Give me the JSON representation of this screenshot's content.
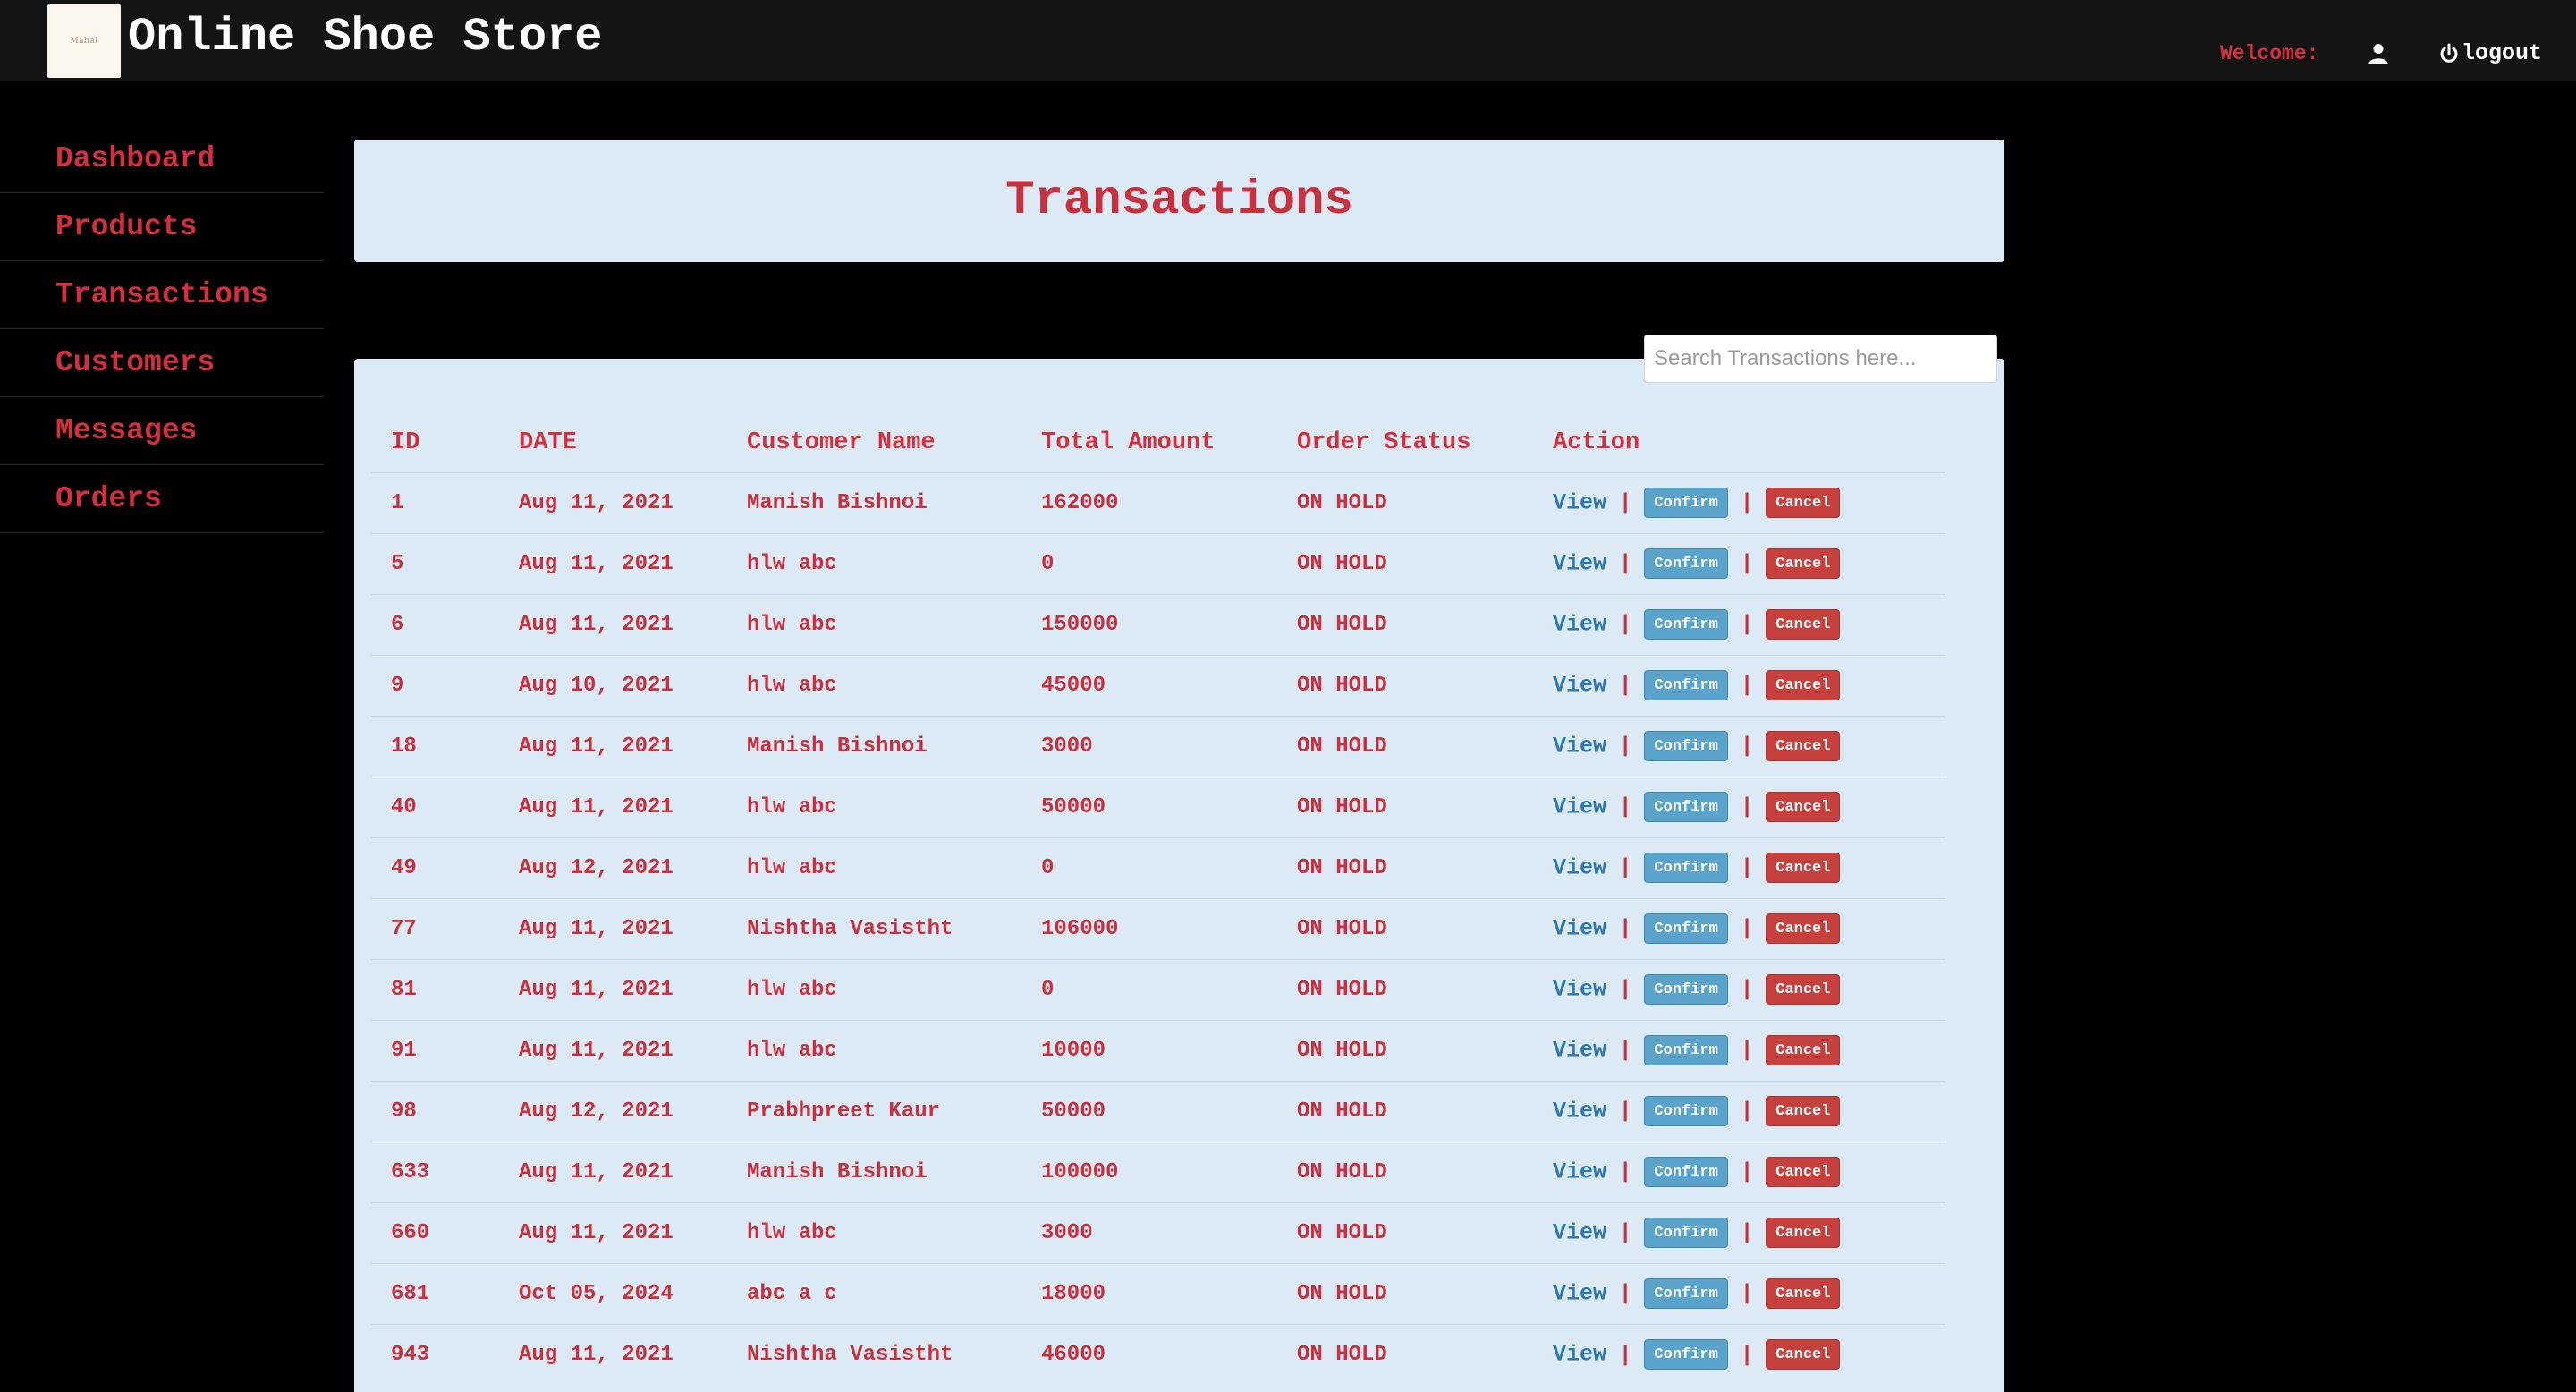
{
  "header": {
    "brand": "Online Shoe Store",
    "logo_text": "Mahal",
    "welcome": "Welcome:",
    "logout": "logout"
  },
  "sidebar": {
    "items": [
      {
        "label": "Dashboard"
      },
      {
        "label": "Products"
      },
      {
        "label": "Transactions"
      },
      {
        "label": "Customers"
      },
      {
        "label": "Messages"
      },
      {
        "label": "Orders"
      }
    ]
  },
  "page": {
    "title": "Transactions",
    "search_placeholder": "Search Transactions here..."
  },
  "table": {
    "columns": [
      "ID",
      "DATE",
      "Customer Name",
      "Total Amount",
      "Order Status",
      "Action"
    ],
    "actions": {
      "view": "View",
      "confirm": "Confirm",
      "cancel": "Cancel",
      "separator": "|"
    },
    "rows": [
      {
        "id": "1",
        "date": "Aug 11, 2021",
        "customer": "Manish Bishnoi",
        "amount": "162000",
        "status": "ON HOLD"
      },
      {
        "id": "5",
        "date": "Aug 11, 2021",
        "customer": "hlw abc",
        "amount": "0",
        "status": "ON HOLD"
      },
      {
        "id": "6",
        "date": "Aug 11, 2021",
        "customer": "hlw abc",
        "amount": "150000",
        "status": "ON HOLD"
      },
      {
        "id": "9",
        "date": "Aug 10, 2021",
        "customer": "hlw abc",
        "amount": "45000",
        "status": "ON HOLD"
      },
      {
        "id": "18",
        "date": "Aug 11, 2021",
        "customer": "Manish Bishnoi",
        "amount": "3000",
        "status": "ON HOLD"
      },
      {
        "id": "40",
        "date": "Aug 11, 2021",
        "customer": "hlw abc",
        "amount": "50000",
        "status": "ON HOLD"
      },
      {
        "id": "49",
        "date": "Aug 12, 2021",
        "customer": "hlw abc",
        "amount": "0",
        "status": "ON HOLD"
      },
      {
        "id": "77",
        "date": "Aug 11, 2021",
        "customer": "Nishtha Vasistht",
        "amount": "106000",
        "status": "ON HOLD"
      },
      {
        "id": "81",
        "date": "Aug 11, 2021",
        "customer": "hlw abc",
        "amount": "0",
        "status": "ON HOLD"
      },
      {
        "id": "91",
        "date": "Aug 11, 2021",
        "customer": "hlw abc",
        "amount": "10000",
        "status": "ON HOLD"
      },
      {
        "id": "98",
        "date": "Aug 12, 2021",
        "customer": "Prabhpreet Kaur",
        "amount": "50000",
        "status": "ON HOLD"
      },
      {
        "id": "633",
        "date": "Aug 11, 2021",
        "customer": "Manish Bishnoi",
        "amount": "100000",
        "status": "ON HOLD"
      },
      {
        "id": "660",
        "date": "Aug 11, 2021",
        "customer": "hlw abc",
        "amount": "3000",
        "status": "ON HOLD"
      },
      {
        "id": "681",
        "date": "Oct 05, 2024",
        "customer": "abc a c",
        "amount": "18000",
        "status": "ON HOLD"
      },
      {
        "id": "943",
        "date": "Aug 11, 2021",
        "customer": "Nishtha Vasistht",
        "amount": "46000",
        "status": "ON HOLD"
      }
    ]
  },
  "colors": {
    "accent_red": "#d2303d",
    "panel_bg": "#dceaf6",
    "link_blue": "#2d78b4",
    "confirm_blue": "#5aa3cb",
    "cancel_red": "#c6413e"
  },
  "icons": {
    "user": "user-icon",
    "logout": "power-icon"
  }
}
